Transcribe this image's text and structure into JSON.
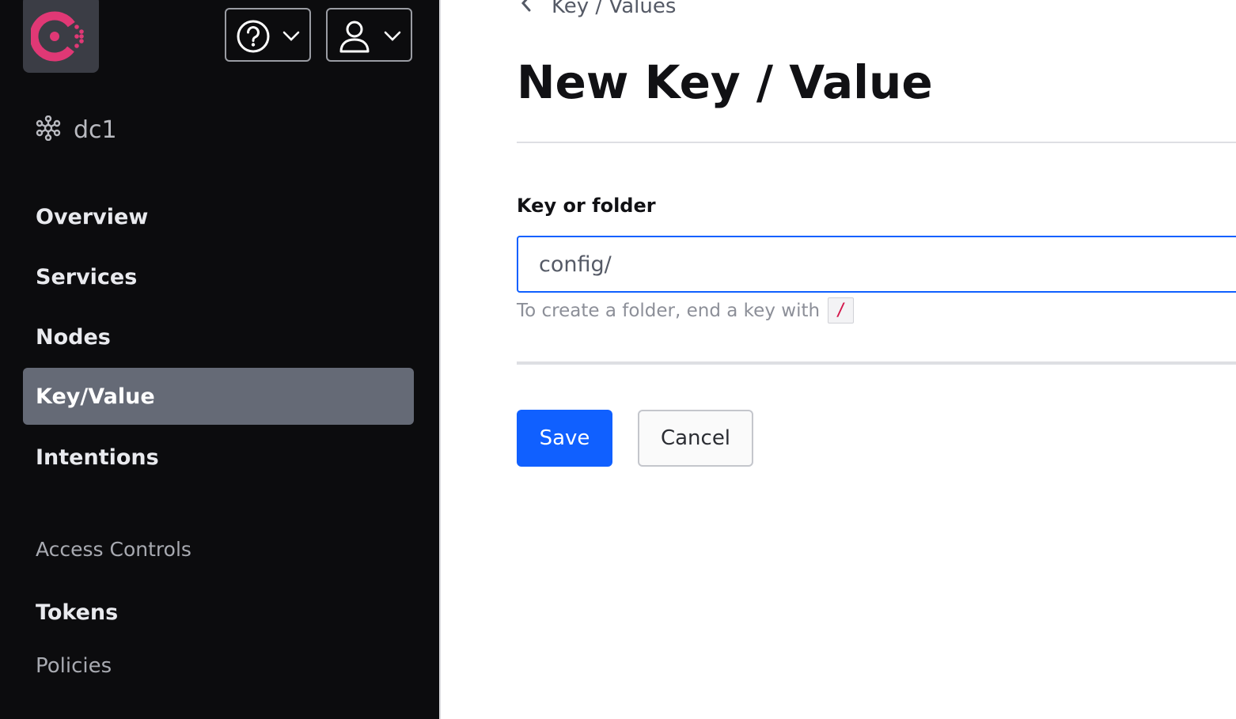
{
  "colors": {
    "sidebar_bg": "#0c0c0e",
    "active_nav_bg": "#656a76",
    "primary": "#1060ff",
    "brand": "#e03875",
    "code_text": "#d3164a"
  },
  "header": {
    "logo_icon": "consul-logo-icon",
    "help_icon": "help-circle-icon",
    "user_icon": "user-icon",
    "dropdown_icon": "chevron-down-icon"
  },
  "sidebar": {
    "datacenter": {
      "icon": "datacenter-icon",
      "label": "dc1"
    },
    "nav": [
      {
        "label": "Overview",
        "active": false
      },
      {
        "label": "Services",
        "active": false
      },
      {
        "label": "Nodes",
        "active": false
      },
      {
        "label": "Key/Value",
        "active": true
      },
      {
        "label": "Intentions",
        "active": false
      }
    ],
    "access_controls": {
      "heading": "Access Controls",
      "items": [
        {
          "label": "Tokens",
          "active": false
        },
        {
          "label": "Policies",
          "active": false
        }
      ]
    }
  },
  "main": {
    "breadcrumb": {
      "icon": "chevron-left-icon",
      "label": "Key / Values"
    },
    "title": "New Key / Value",
    "form": {
      "key_label": "Key or folder",
      "key_value": "config/",
      "help_text": "To create a folder, end a key with",
      "help_code": "/"
    },
    "actions": {
      "save_label": "Save",
      "cancel_label": "Cancel"
    }
  }
}
